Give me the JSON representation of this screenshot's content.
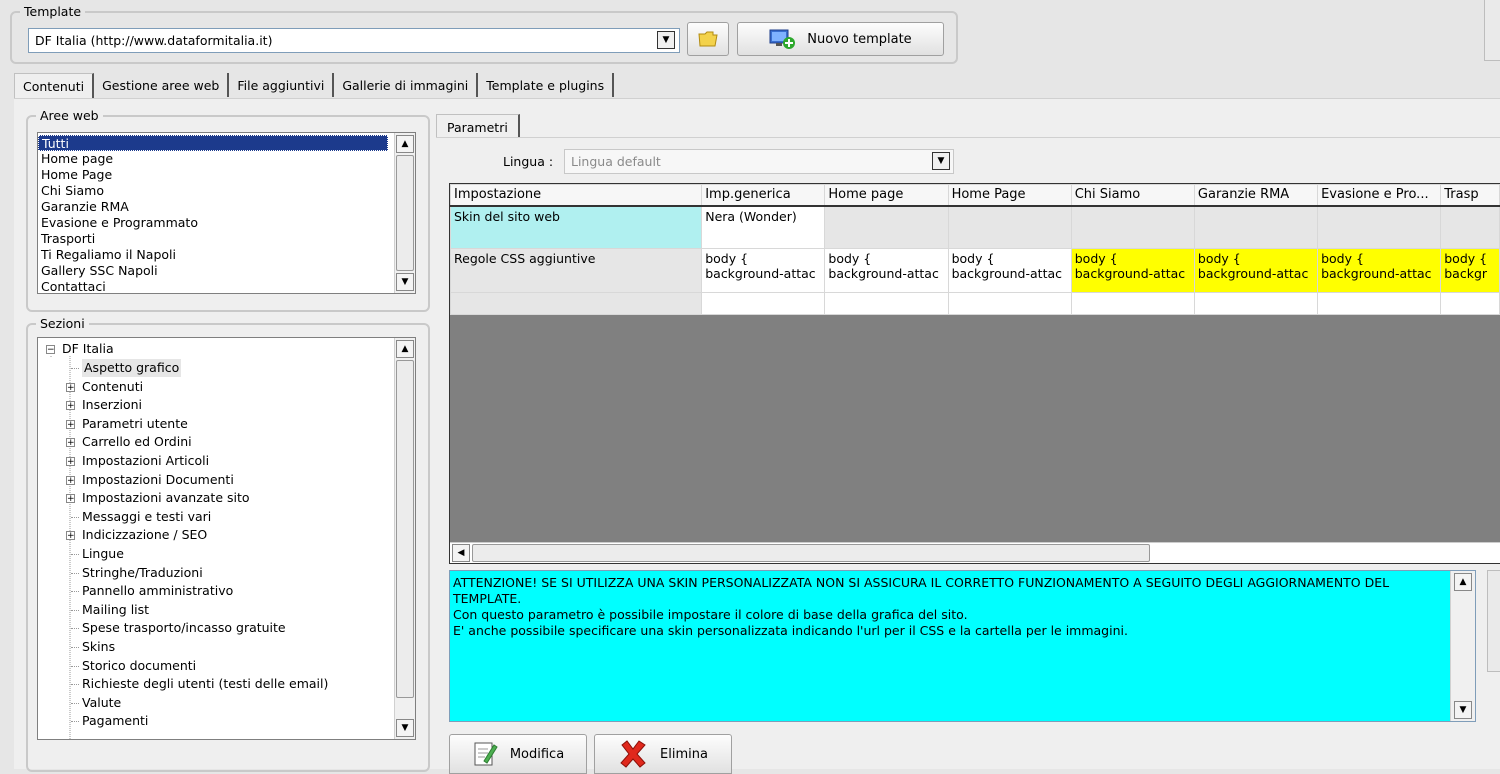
{
  "template": {
    "legend": "Template",
    "selected": "DF Italia (http://www.dataformitalia.it)",
    "new_button": "Nuovo template",
    "folder_icon": "folder-icon",
    "new_icon": "monitor-add-icon"
  },
  "tabs": [
    "Contenuti",
    "Gestione aree web",
    "File aggiuntivi",
    "Gallerie di immagini",
    "Template e plugins"
  ],
  "aree_web": {
    "legend": "Aree web",
    "items": [
      "Tutti",
      "Home page",
      "Home Page",
      "Chi Siamo",
      "Garanzie RMA",
      "Evasione e Programmato",
      "Trasporti",
      "Ti Regaliamo il Napoli",
      "Gallery SSC Napoli",
      "Contattaci"
    ],
    "selected": "Tutti"
  },
  "sezioni": {
    "legend": "Sezioni",
    "root": "DF Italia",
    "items": [
      {
        "label": "Aspetto grafico",
        "expandable": false,
        "selected": true
      },
      {
        "label": "Contenuti",
        "expandable": true
      },
      {
        "label": "Inserzioni",
        "expandable": true
      },
      {
        "label": "Parametri utente",
        "expandable": true
      },
      {
        "label": "Carrello ed Ordini",
        "expandable": true
      },
      {
        "label": "Impostazioni Articoli",
        "expandable": true
      },
      {
        "label": "Impostazioni Documenti",
        "expandable": true
      },
      {
        "label": "Impostazioni avanzate sito",
        "expandable": true
      },
      {
        "label": "Messaggi e testi vari",
        "expandable": false
      },
      {
        "label": "Indicizzazione / SEO",
        "expandable": true
      },
      {
        "label": "Lingue",
        "expandable": false
      },
      {
        "label": "Stringhe/Traduzioni",
        "expandable": false
      },
      {
        "label": "Pannello amministrativo",
        "expandable": false
      },
      {
        "label": "Mailing list",
        "expandable": false
      },
      {
        "label": "Spese trasporto/incasso gratuite",
        "expandable": false
      },
      {
        "label": "Skins",
        "expandable": false
      },
      {
        "label": "Storico documenti",
        "expandable": false
      },
      {
        "label": "Richieste degli utenti (testi delle email)",
        "expandable": false
      },
      {
        "label": "Valute",
        "expandable": false
      },
      {
        "label": "Pagamenti",
        "expandable": false
      }
    ]
  },
  "parametri": {
    "tab": "Parametri",
    "lingua_label": "Lingua :",
    "lingua_value": "Lingua default",
    "columns": [
      "Impostazione",
      "Imp.generica",
      "Home page",
      "Home Page",
      "Chi Siamo",
      "Garanzie RMA",
      "Evasione e Pro...",
      "Trasp"
    ],
    "rows": [
      {
        "name": "Skin del sito web",
        "cells": [
          "Nera (Wonder)",
          "",
          "",
          "",
          "",
          "",
          ""
        ]
      },
      {
        "name": "Regole CSS aggiuntive",
        "cells": [
          "body {\nbackground-attac",
          "body {\nbackground-attac",
          "body {\nbackground-attac",
          "body {\nbackground-attac",
          "body {\nbackground-attac",
          "body {\nbackground-attac",
          "body {\nbackgr"
        ]
      }
    ],
    "colors": {
      "name_selected": "#b0f0f0",
      "highlight": "#ffff00",
      "grid_empty": "#808080"
    }
  },
  "info": {
    "line1": "ATTENZIONE! SE SI UTILIZZA UNA SKIN PERSONALIZZATA NON SI ASSICURA IL CORRETTO FUNZIONAMENTO A SEGUITO DEGLI AGGIORNAMENTO DEL TEMPLATE.",
    "line2": "Con questo parametro è possibile impostare il colore di base della grafica del sito.",
    "line3": "E' anche possibile specificare una skin personalizzata indicando l'url per il CSS e la cartella per le immagini."
  },
  "actions": {
    "modifica": "Modifica",
    "elimina": "Elimina",
    "modifica_icon": "edit-document-icon",
    "elimina_icon": "red-x-icon"
  }
}
